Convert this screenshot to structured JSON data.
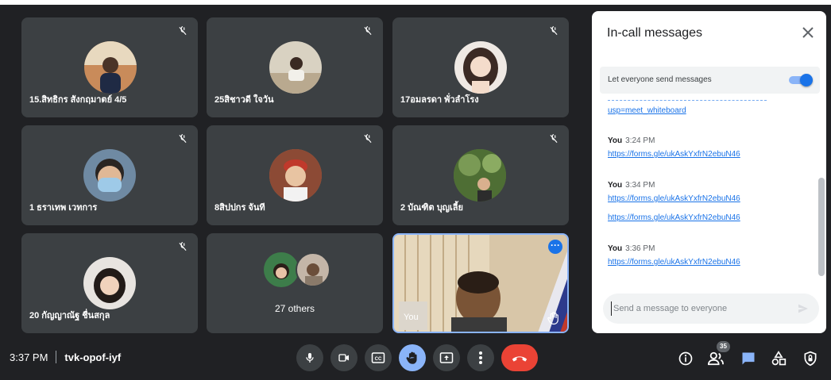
{
  "participants": [
    {
      "name": "15.สิทธิกร สังกฤมาตย์ 4/5",
      "avatar_bg": "#c98b5a"
    },
    {
      "name": "25สิชาวดี ใจวัน",
      "avatar_bg": "#d9d2c2"
    },
    {
      "name": "17อมลรดา พั่วลำโรง",
      "avatar_bg": "#efe9e4"
    },
    {
      "name": "1 ธราเทพ เวทการ",
      "avatar_bg": "#6f8aa3"
    },
    {
      "name": "8สิปปกร จันที",
      "avatar_bg": "#b06a4a"
    },
    {
      "name": "2 บัณฑิต บุญเลี้ย",
      "avatar_bg": "#5a7a3e"
    },
    {
      "name": "20 กัญญาณัฐ ชื่นสกุล",
      "avatar_bg": "#e8e4e0"
    }
  ],
  "others_tile": {
    "label": "27 others"
  },
  "self_tile": {
    "label": "You"
  },
  "chat_panel": {
    "title": "In-call messages",
    "setting_label": "Let everyone send messages",
    "setting_enabled": true,
    "partial_link": "usp=meet_whiteboard",
    "messages": [
      {
        "sender": "You",
        "time": "3:24 PM",
        "links": [
          "https://forms.gle/ukAskYxfrN2ebuN46"
        ]
      },
      {
        "sender": "You",
        "time": "3:34 PM",
        "links": [
          "https://forms.gle/ukAskYxfrN2ebuN46",
          "https://forms.gle/ukAskYxfrN2ebuN46"
        ]
      },
      {
        "sender": "You",
        "time": "3:36 PM",
        "links": [
          "https://forms.gle/ukAskYxfrN2ebuN46"
        ]
      }
    ],
    "compose_placeholder": "Send a message to everyone"
  },
  "bottom_bar": {
    "time": "3:37 PM",
    "meeting_code": "tvk-opof-iyf",
    "people_count": "35"
  },
  "colors": {
    "end_call": "#ea4335",
    "accent": "#1a73e8",
    "raise_hand": "#8ab4f8"
  }
}
